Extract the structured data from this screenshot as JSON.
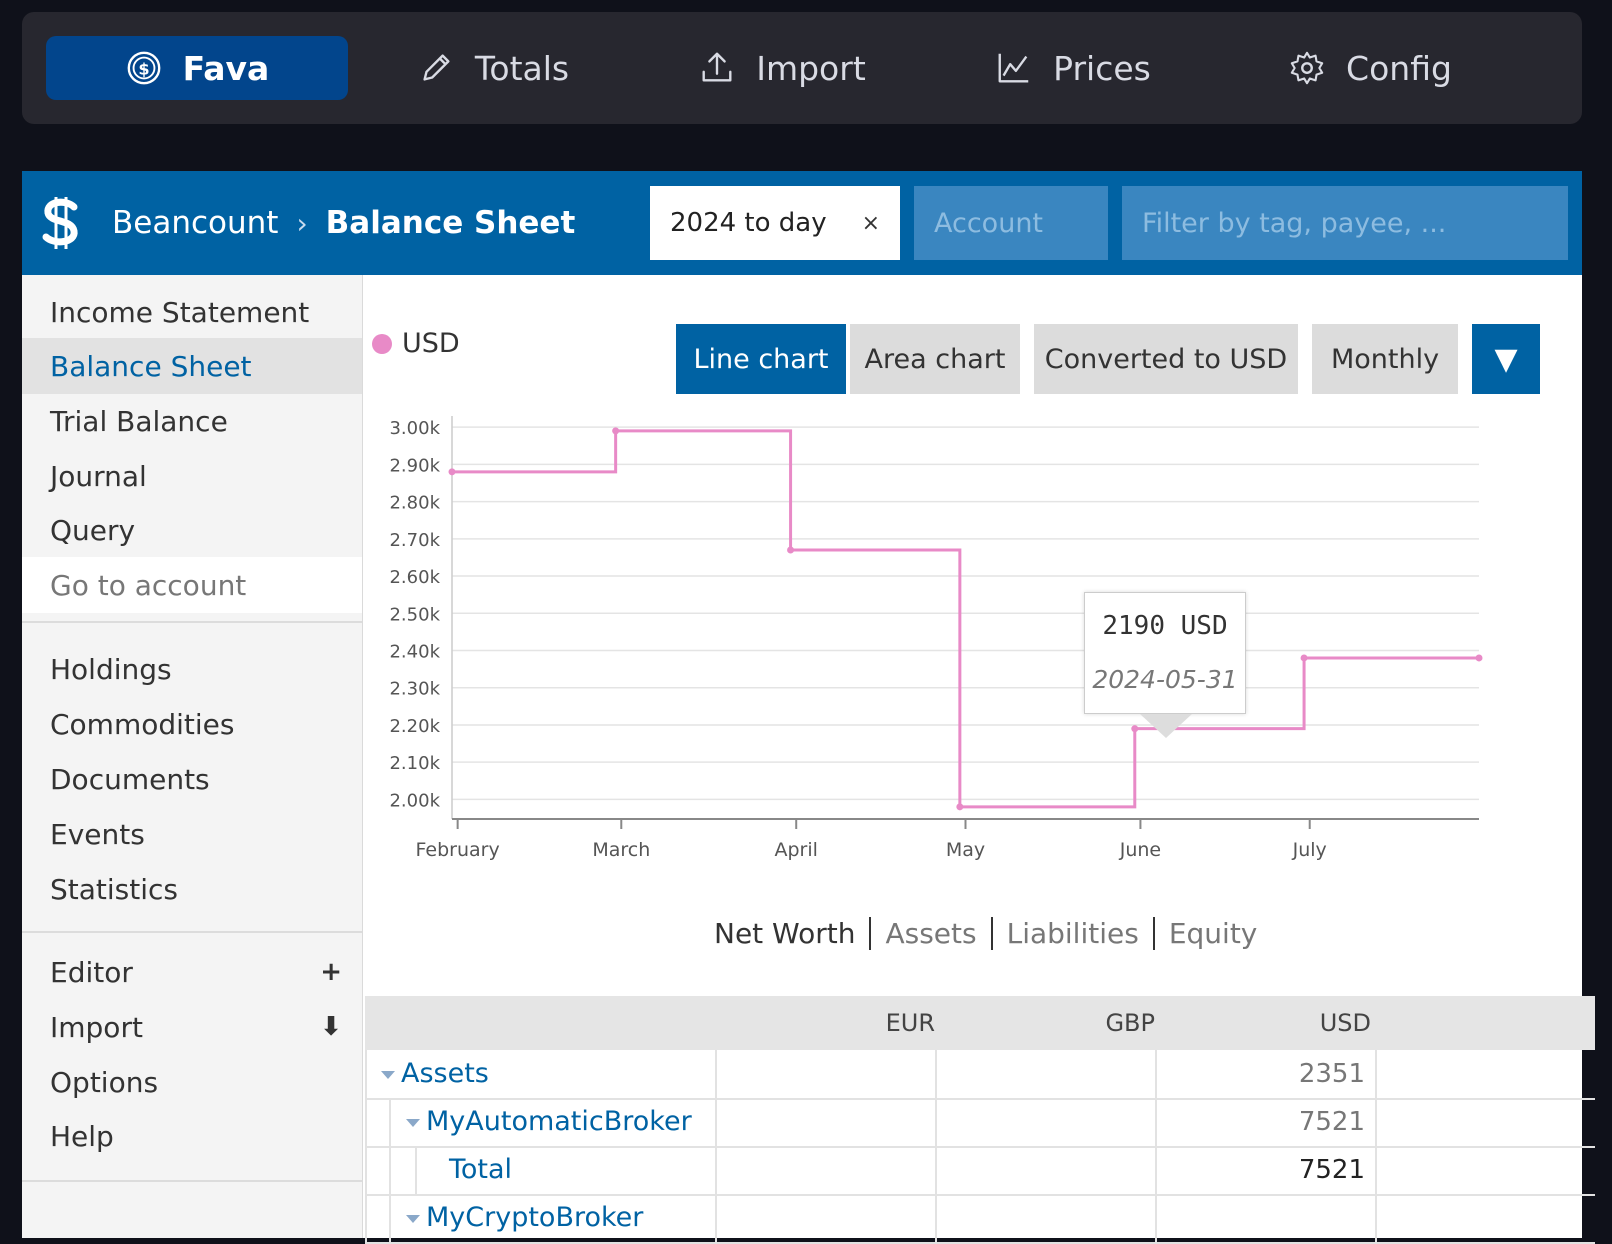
{
  "appbar": {
    "tabs": [
      {
        "label": "Fava",
        "icon": "dollar-coin-icon",
        "active": true
      },
      {
        "label": "Totals",
        "icon": "pencil-icon"
      },
      {
        "label": "Import",
        "icon": "upload-icon"
      },
      {
        "label": "Prices",
        "icon": "line-chart-icon"
      },
      {
        "label": "Config",
        "icon": "gear-icon"
      }
    ]
  },
  "header": {
    "app": "Beancount",
    "separator": "›",
    "page": "Balance Sheet",
    "time_filter": {
      "value": "2024 to day",
      "clear": "×"
    },
    "account_filter": {
      "placeholder": "Account"
    },
    "tag_filter": {
      "placeholder": "Filter by tag, payee, ..."
    }
  },
  "sidebar": {
    "items": [
      {
        "label": "Income Statement"
      },
      {
        "label": "Balance Sheet",
        "active": true
      },
      {
        "label": "Trial Balance"
      },
      {
        "label": "Journal"
      },
      {
        "label": "Query"
      },
      {
        "label": "Go to account"
      },
      {
        "label": "Holdings"
      },
      {
        "label": "Commodities"
      },
      {
        "label": "Documents"
      },
      {
        "label": "Events"
      },
      {
        "label": "Statistics"
      },
      {
        "label": "Editor",
        "action": "+"
      },
      {
        "label": "Import",
        "action": "⬇"
      },
      {
        "label": "Options"
      },
      {
        "label": "Help"
      }
    ]
  },
  "chart_controls": {
    "legend_label": "USD",
    "legend_color": "#e88ac7",
    "buttons": {
      "line": "Line chart",
      "area": "Area chart",
      "converted": "Converted to USD",
      "interval": "Monthly",
      "more": "▼"
    }
  },
  "chart_data": {
    "type": "line",
    "step": true,
    "x": [
      "2024-01-31",
      "2024-02-29",
      "2024-03-31",
      "2024-04-30",
      "2024-05-31",
      "2024-06-30",
      "2024-07-31"
    ],
    "series": [
      {
        "name": "USD",
        "color": "#e88ac7",
        "values": [
          2880,
          2990,
          2670,
          1980,
          2190,
          2380,
          2380
        ]
      }
    ],
    "xticks": [
      "February",
      "March",
      "April",
      "May",
      "June",
      "July"
    ],
    "yticks": [
      "2.00k",
      "2.10k",
      "2.20k",
      "2.30k",
      "2.40k",
      "2.50k",
      "2.60k",
      "2.70k",
      "2.80k",
      "2.90k",
      "3.00k"
    ],
    "ylim": [
      1950,
      3030
    ],
    "grid": true
  },
  "tooltip": {
    "value": "2190 USD",
    "date": "2024-05-31"
  },
  "chart_tabs": [
    "Net Worth",
    "Assets",
    "Liabilities",
    "Equity"
  ],
  "table": {
    "headers": [
      "EUR",
      "GBP",
      "USD"
    ],
    "rows": [
      {
        "name": "Assets",
        "usd": "2351",
        "toggle": true
      },
      {
        "name": "MyAutomaticBroker",
        "usd": "7521",
        "toggle": true
      },
      {
        "name": "Total",
        "usd": "7521"
      },
      {
        "name": "MyCryptoBroker",
        "usd": "",
        "toggle": true
      }
    ]
  }
}
